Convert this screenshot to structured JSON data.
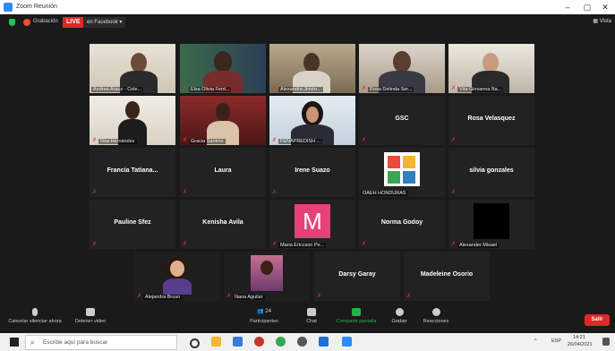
{
  "window": {
    "title": "Zoom Reunión",
    "minimize": "–",
    "maximize": "▢",
    "close": "✕"
  },
  "topbar": {
    "recording_label": "Grabación",
    "live_badge": "LIVE",
    "live_platform": "en Facebook ▾",
    "view_label": "▦ Vista"
  },
  "participants": {
    "r1c1": "Andrea Arauz - Cole...",
    "r1c2": "Elsa Olivia Ferd...",
    "r1c3": "Alexandra Jimén...",
    "r1c4": "Rosa Delinda Ser...",
    "r1c5": "Vita Giovanna Ba...",
    "r2c1": "Noa Hernández",
    "r2c2": "Gracia Santres",
    "r2c3": "FENAPREDISH ...",
    "r2c4": "GSC",
    "r2c5": "Rosa Velasquez",
    "r3c1": "Francia Tatiana...",
    "r3c2": "Laura",
    "r3c3": "Irene Suazo",
    "r3c4": "OAEH HONDURAS",
    "r3c5": "silvia gonzales",
    "r4c1": "Pauline Sfez",
    "r4c2": "Kenisha Avila",
    "r4c3": "Maria Ericcson Pe...",
    "r4c3_initial": "M",
    "r4c4": "Norma Godoy",
    "r4c5": "Alexander Misael",
    "r5c1": "Alejandra Bruso",
    "r5c2": "Iliana Aguilar",
    "r5c3": "Darsy Garay",
    "r5c4": "Madeleine Osorio"
  },
  "toolbar": {
    "mute": "Cancelar silenciar ahora",
    "video": "Detener video",
    "participants": "Participantes",
    "participants_count": "24",
    "chat": "Chat",
    "share": "Compartir pantalla",
    "record": "Grabar",
    "reactions": "Reacciones",
    "leave": "Salir"
  },
  "taskbar": {
    "search_placeholder": "Escribe aquí para buscar",
    "tray_lang": "ESP",
    "time": "14:21",
    "date": "26/04/2021"
  },
  "colors": {
    "active_speaker": "#c9e03a",
    "live": "#e02828",
    "share_green": "#22b14c",
    "avatar_pink": "#e8417a"
  }
}
